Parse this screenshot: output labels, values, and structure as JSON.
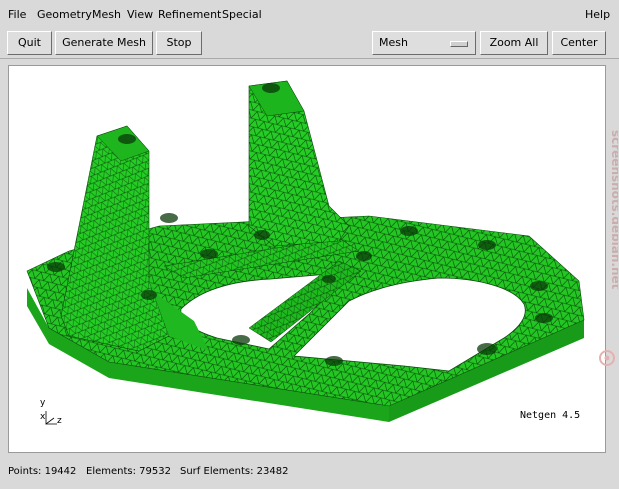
{
  "menubar": {
    "items": [
      {
        "label": "File"
      },
      {
        "label": "Geometry"
      },
      {
        "label": "Mesh"
      },
      {
        "label": "View"
      },
      {
        "label": "Refinement"
      },
      {
        "label": "Special"
      }
    ],
    "help": {
      "label": "Help"
    }
  },
  "toolbar": {
    "quit_label": "Quit",
    "generate_label": "Generate Mesh",
    "stop_label": "Stop",
    "mode_select_value": "Mesh",
    "zoom_all_label": "Zoom All",
    "center_label": "Center"
  },
  "viewport": {
    "brand_label": "Netgen 4.5",
    "axis_labels": {
      "y": "y",
      "x": "x",
      "z": "z"
    },
    "mesh_color": "#21c421",
    "edge_color": "#062806"
  },
  "status": {
    "points": "Points: 19442",
    "elements": "Elements: 79532",
    "surf_elements": "Surf Elements: 23482"
  },
  "watermark": {
    "text": "screenshots.debian.net"
  }
}
